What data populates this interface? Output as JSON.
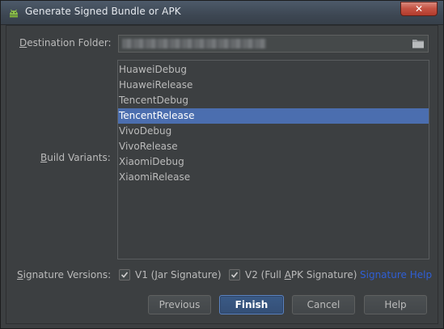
{
  "window": {
    "title": "Generate Signed Bundle or APK",
    "close_label": "✕"
  },
  "destination": {
    "label_prefix": "",
    "label_mnemonic": "D",
    "label_rest": "estination Folder:",
    "value": ""
  },
  "build_variants": {
    "label_prefix": "",
    "label_mnemonic": "B",
    "label_rest": "uild Variants:",
    "items": [
      "HuaweiDebug",
      "HuaweiRelease",
      "TencentDebug",
      "TencentRelease",
      "VivoDebug",
      "VivoRelease",
      "XiaomiDebug",
      "XiaomiRelease"
    ],
    "selected": "TencentRelease"
  },
  "signature": {
    "label_prefix": "",
    "label_mnemonic": "S",
    "label_rest": "ignature Versions:",
    "v1": {
      "checked": true,
      "label_before": "V1 (",
      "label_mnemonic": "J",
      "label_after": "ar Signature)"
    },
    "v2": {
      "checked": true,
      "label_before": "V2 (Full ",
      "label_mnemonic": "A",
      "label_after": "PK Signature)"
    },
    "help_link": "Signature Help"
  },
  "buttons": {
    "previous": "Previous",
    "finish": "Finish",
    "cancel": "Cancel",
    "help": "Help"
  },
  "colors": {
    "selection": "#4b6eaf",
    "link": "#2f5fd6",
    "background": "#3c3f41"
  }
}
